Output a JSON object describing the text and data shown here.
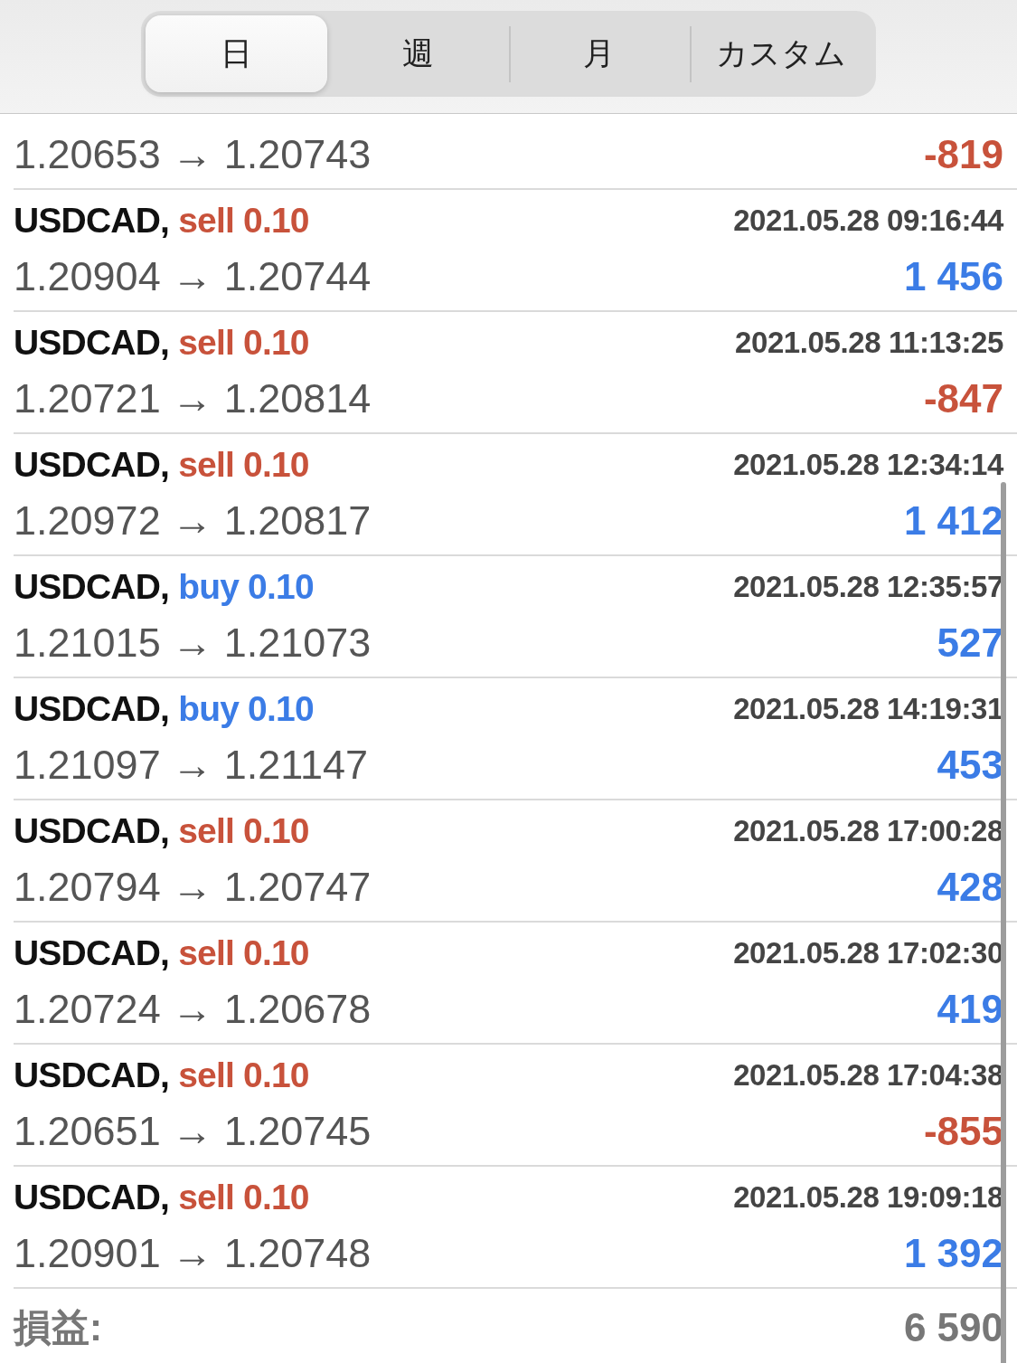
{
  "periods": [
    {
      "label": "日",
      "selected": true
    },
    {
      "label": "週",
      "selected": false
    },
    {
      "label": "月",
      "selected": false
    },
    {
      "label": "カスタム",
      "selected": false
    }
  ],
  "trades": [
    {
      "prices": "1.20653 → 1.20743",
      "profit": {
        "text": "-819",
        "color": "#c8523b"
      }
    },
    {
      "symbol": "USDCAD,",
      "order": {
        "text": "sell 0.10",
        "color": "#c8523b"
      },
      "time": "2021.05.28 09:16:44",
      "prices": "1.20904 → 1.20744",
      "profit": {
        "text": "1 456",
        "color": "#3b7ce6"
      }
    },
    {
      "symbol": "USDCAD,",
      "order": {
        "text": "sell 0.10",
        "color": "#c8523b"
      },
      "time": "2021.05.28 11:13:25",
      "prices": "1.20721 → 1.20814",
      "profit": {
        "text": "-847",
        "color": "#c8523b"
      }
    },
    {
      "symbol": "USDCAD,",
      "order": {
        "text": "sell 0.10",
        "color": "#c8523b"
      },
      "time": "2021.05.28 12:34:14",
      "prices": "1.20972 → 1.20817",
      "profit": {
        "text": "1 412",
        "color": "#3b7ce6"
      }
    },
    {
      "symbol": "USDCAD,",
      "order": {
        "text": "buy 0.10",
        "color": "#3b7ce6"
      },
      "time": "2021.05.28 12:35:57",
      "prices": "1.21015 → 1.21073",
      "profit": {
        "text": "527",
        "color": "#3b7ce6"
      }
    },
    {
      "symbol": "USDCAD,",
      "order": {
        "text": "buy 0.10",
        "color": "#3b7ce6"
      },
      "time": "2021.05.28 14:19:31",
      "prices": "1.21097 → 1.21147",
      "profit": {
        "text": "453",
        "color": "#3b7ce6"
      }
    },
    {
      "symbol": "USDCAD,",
      "order": {
        "text": "sell 0.10",
        "color": "#c8523b"
      },
      "time": "2021.05.28 17:00:28",
      "prices": "1.20794 → 1.20747",
      "profit": {
        "text": "428",
        "color": "#3b7ce6"
      }
    },
    {
      "symbol": "USDCAD,",
      "order": {
        "text": "sell 0.10",
        "color": "#c8523b"
      },
      "time": "2021.05.28 17:02:30",
      "prices": "1.20724 → 1.20678",
      "profit": {
        "text": "419",
        "color": "#3b7ce6"
      }
    },
    {
      "symbol": "USDCAD,",
      "order": {
        "text": "sell 0.10",
        "color": "#c8523b"
      },
      "time": "2021.05.28 17:04:38",
      "prices": "1.20651 → 1.20745",
      "profit": {
        "text": "-855",
        "color": "#c8523b"
      }
    },
    {
      "symbol": "USDCAD,",
      "order": {
        "text": "sell 0.10",
        "color": "#c8523b"
      },
      "time": "2021.05.28 19:09:18",
      "prices": "1.20901 → 1.20748",
      "profit": {
        "text": "1 392",
        "color": "#3b7ce6"
      }
    }
  ],
  "summary": {
    "label": "損益:",
    "value": "6 590"
  }
}
